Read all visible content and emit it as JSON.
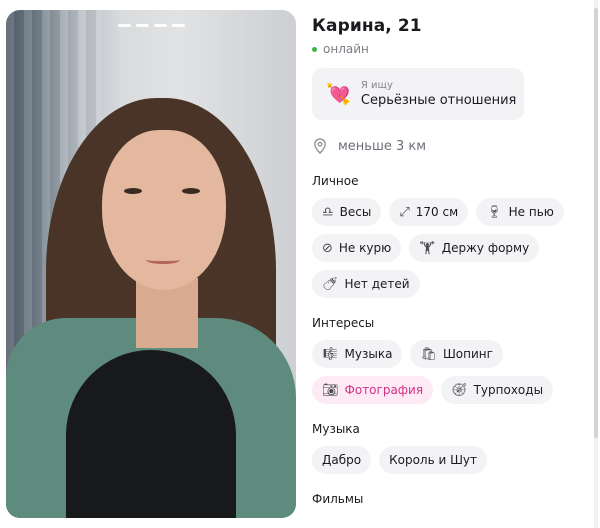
{
  "profile": {
    "name_age": "Карина, 21",
    "status": "онлайн",
    "looking_for": {
      "label": "Я ищу",
      "value": "Серьёзные отношения",
      "icon": "heart-arrow-icon"
    },
    "distance": "меньше 3 км"
  },
  "sections": {
    "personal": {
      "title": "Личное",
      "chips": [
        {
          "label": "Весы",
          "icon": "libra-icon"
        },
        {
          "label": "170 см",
          "icon": "height-arrows-icon"
        },
        {
          "label": "Не пью",
          "icon": "wine-glass-icon"
        },
        {
          "label": "Не курю",
          "icon": "no-smoking-icon"
        },
        {
          "label": "Держу форму",
          "icon": "dumbbell-icon"
        },
        {
          "label": "Нет детей",
          "icon": "baby-bottle-icon"
        }
      ]
    },
    "interests": {
      "title": "Интересы",
      "chips": [
        {
          "label": "Музыка",
          "icon": "music-score-icon"
        },
        {
          "label": "Шопинг",
          "icon": "shopping-bags-icon"
        },
        {
          "label": "Фотография",
          "icon": "camera-icon"
        },
        {
          "label": "Турпоходы",
          "icon": "compass-icon"
        }
      ]
    },
    "music": {
      "title": "Музыка",
      "chips": [
        {
          "label": "Дабро"
        },
        {
          "label": "Король и Шут"
        }
      ]
    },
    "movies": {
      "title": "Фильмы"
    }
  },
  "colors": {
    "online": "#38b54a",
    "highlight_text": "#d1338a",
    "highlight_bg": "#fdeaf4",
    "chip_bg": "#f3f3f6"
  }
}
